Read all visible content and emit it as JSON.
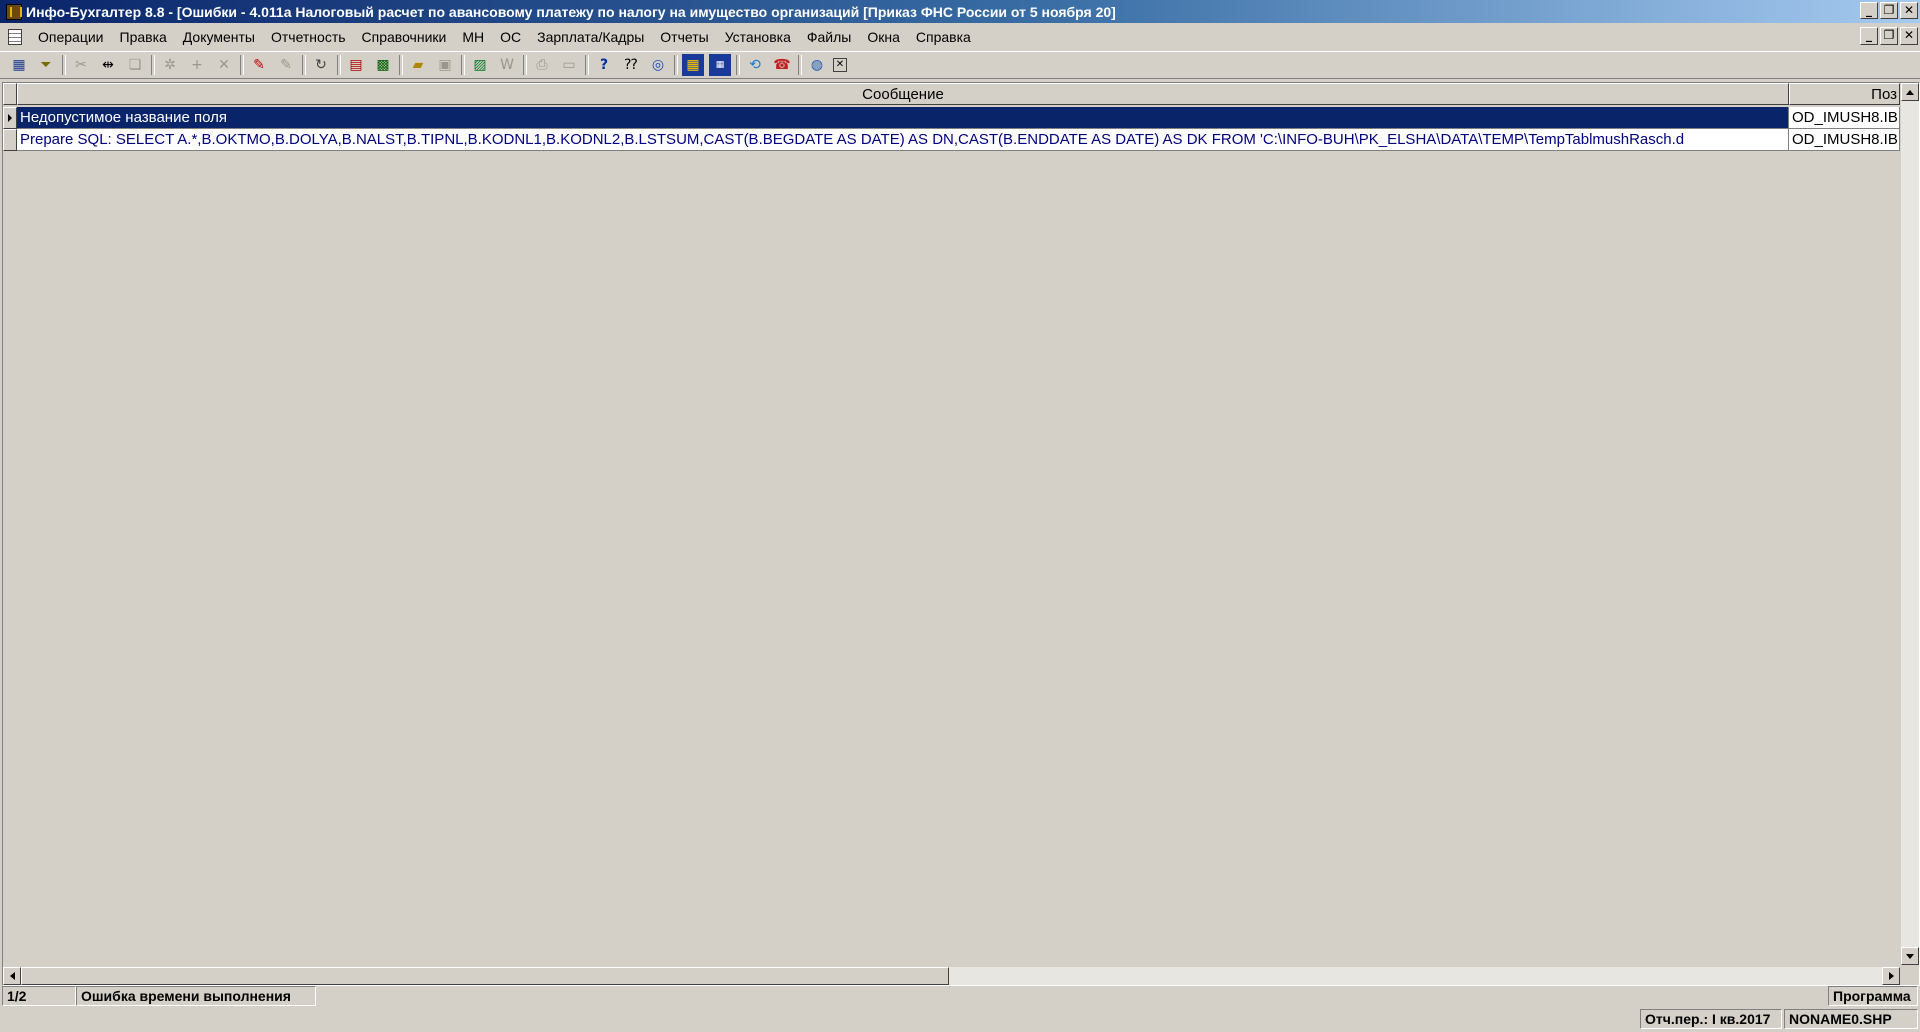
{
  "window": {
    "title": "Инфо-Бухгалтер 8.8 - [Ошибки -     4.011а Налоговый расчет по авансовому платежу по налогу на имущество организаций [Приказ ФНС России от 5 ноября 20]",
    "minimize_glyph": "_",
    "restore_glyph": "❐",
    "close_glyph": "✕"
  },
  "menu": {
    "items": [
      "Операции",
      "Правка",
      "Документы",
      "Отчетность",
      "Справочники",
      "МН",
      "ОС",
      "Зарплата/Кадры",
      "Отчеты",
      "Установка",
      "Файлы",
      "Окна",
      "Справка"
    ]
  },
  "toolbar": {
    "icons": [
      "grid-view-icon",
      "filter-icon",
      "cut-icon",
      "split-icon",
      "copy-doc-icon",
      "settings-icon",
      "add-icon",
      "delete-icon",
      "mark-icon",
      "unmark-icon",
      "refresh-icon",
      "pdf-icon",
      "calculator-icon",
      "open-folder-icon",
      "save-icon",
      "excel-icon",
      "word-icon",
      "print-icon",
      "preview-icon",
      "help-icon",
      "context-help-icon",
      "compass-icon",
      "calendar-icon",
      "ms10-icon",
      "exchange-icon",
      "support-icon",
      "web-icon",
      "close-window-icon"
    ]
  },
  "grid": {
    "columns": {
      "message": "Сообщение",
      "position": "Поз"
    },
    "rows": [
      {
        "message": "Недопустимое название поля",
        "position": "OD_IMUSH8.IB",
        "selected": true
      },
      {
        "message": "Prepare SQL: SELECT A.*,B.OKTMO,B.DOLYA,B.NALST,B.TIPNL,B.KODNL1,B.KODNL2,B.LSTSUM,CAST(B.BEGDATE AS DATE) AS DN,CAST(B.ENDDATE AS DATE) AS DK FROM 'C:\\INFO-BUH\\PK_ELSHA\\DATA\\TEMP\\TempTablmushRasch.d",
        "position": "OD_IMUSH8.IB",
        "selected": false
      }
    ]
  },
  "status": {
    "record": "1/2",
    "error": "Ошибка времени выполнения",
    "source": "Программа",
    "period": "Отч.пер.: I кв.2017",
    "file": "NONAME0.SHP"
  },
  "colors": {
    "title_start": "#0a246a",
    "title_end": "#a6caf0",
    "selection": "#0a246a",
    "row_text": "#000080",
    "face": "#d4d0c8"
  }
}
